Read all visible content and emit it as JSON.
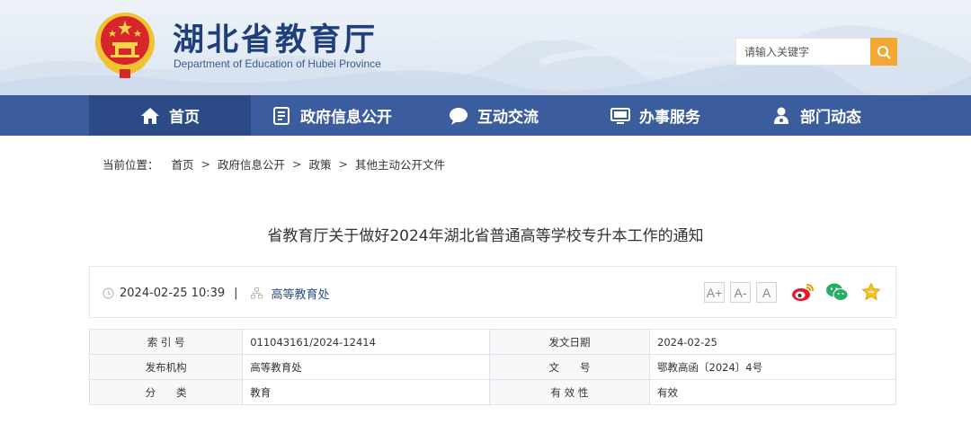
{
  "header": {
    "title": "湖北省教育厅",
    "subtitle": "Department of Education of Hubei Province",
    "search_placeholder": "请输入关键字"
  },
  "nav": [
    {
      "label": "首页",
      "icon": "home-icon",
      "active": true
    },
    {
      "label": "政府信息公开",
      "icon": "document-list-icon",
      "active": false
    },
    {
      "label": "互动交流",
      "icon": "chat-bubble-icon",
      "active": false
    },
    {
      "label": "办事服务",
      "icon": "monitor-icon",
      "active": false
    },
    {
      "label": "部门动态",
      "icon": "person-badge-icon",
      "active": false
    }
  ],
  "breadcrumb": {
    "lead": "当前位置：",
    "items": [
      "首页",
      "政府信息公开",
      "政策",
      "其他主动公开文件"
    ],
    "separator": ">"
  },
  "article": {
    "title": "省教育厅关于做好2024年湖北省普通高等学校专升本工作的通知",
    "datetime": "2024-02-25 10:39",
    "divider": "|",
    "department": "高等教育处"
  },
  "font_controls": [
    "A+",
    "A-",
    "A"
  ],
  "share": [
    "weibo-icon",
    "wechat-icon",
    "favorite-star-icon"
  ],
  "info_table": [
    [
      {
        "key": "索 引 号",
        "value": "011043161/2024-12414"
      },
      {
        "key": "发文日期",
        "value": "2024-02-25"
      }
    ],
    [
      {
        "key": "发布机构",
        "value": "高等教育处"
      },
      {
        "key": "文　　号",
        "value": "鄂教高函〔2024〕4号"
      }
    ],
    [
      {
        "key": "分　　类",
        "value": "教育"
      },
      {
        "key": "有 效 性",
        "value": "有效"
      }
    ]
  ],
  "colors": {
    "nav_bg": "#3b5d9d",
    "nav_active": "#2b4a86",
    "title_blue": "#1f3f7c",
    "search_button": "#f3a834",
    "emblem_red": "#d6262b",
    "emblem_gold": "#f2c230"
  }
}
